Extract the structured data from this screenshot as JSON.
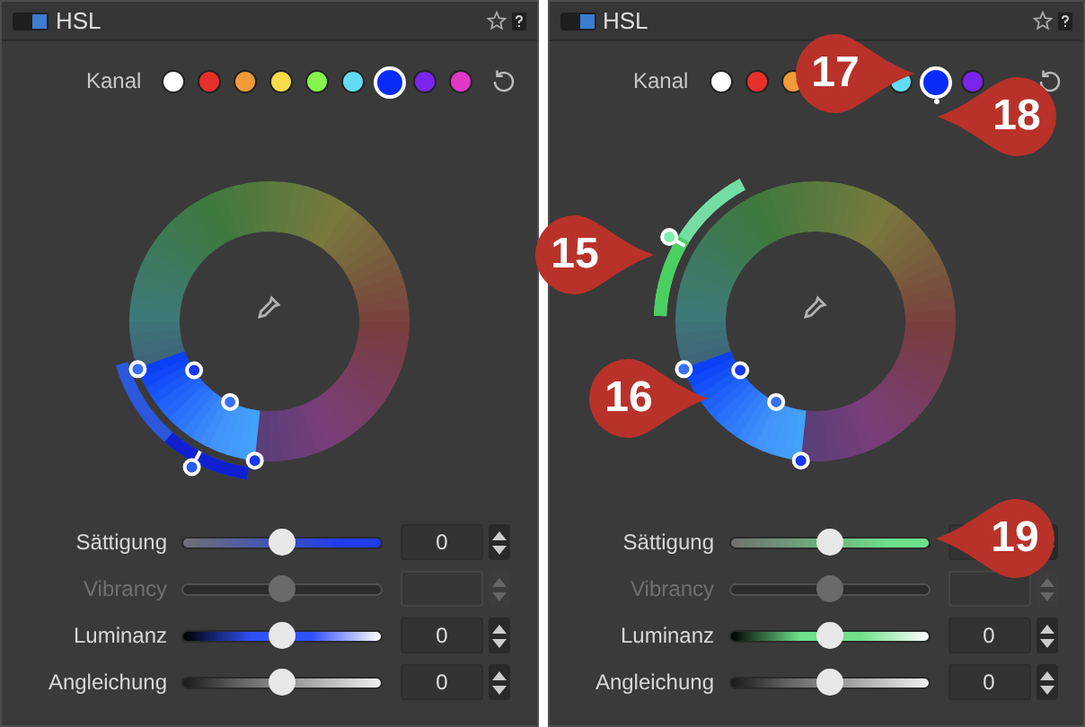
{
  "panels": [
    {
      "title": "HSL",
      "enabled": true,
      "channel_label": "Kanal",
      "channels": [
        {
          "color": "#ffffff",
          "selected": false,
          "modified": false
        },
        {
          "color": "#e8302a",
          "selected": false,
          "modified": false
        },
        {
          "color": "#f09a38",
          "selected": false,
          "modified": false
        },
        {
          "color": "#f6dc48",
          "selected": false,
          "modified": false
        },
        {
          "color": "#86f44a",
          "selected": false,
          "modified": false
        },
        {
          "color": "#62dcf6",
          "selected": false,
          "modified": false
        },
        {
          "color": "#0a2cf8",
          "selected": true,
          "modified": false
        },
        {
          "color": "#7a24f0",
          "selected": false,
          "modified": false
        },
        {
          "color": "#e238c8",
          "selected": false,
          "modified": false
        }
      ],
      "sliders": [
        {
          "label": "Sättigung",
          "kind": "saturation",
          "color": "#1f3cf0",
          "disabled": false,
          "level": 0.5,
          "value": "0"
        },
        {
          "label": "Vibrancy",
          "kind": "vibrancy",
          "disabled": true,
          "level": 0.5
        },
        {
          "label": "Luminanz",
          "kind": "luminance",
          "color": "#3050f8",
          "disabled": false,
          "level": 0.5,
          "value": "0"
        },
        {
          "label": "Angleichung",
          "kind": "blend",
          "disabled": false,
          "level": 0.5,
          "value": "0"
        }
      ]
    },
    {
      "title": "HSL",
      "enabled": true,
      "channel_label": "Kanal",
      "channels": [
        {
          "color": "#ffffff",
          "selected": false,
          "modified": false
        },
        {
          "color": "#e8302a",
          "selected": false,
          "modified": false
        },
        {
          "color": "#f09a38",
          "selected": false,
          "modified": false
        },
        {
          "color": "#62dcf6",
          "selected": false,
          "modified": false
        },
        {
          "color": "#0a2cf8",
          "selected": true,
          "modified": true
        },
        {
          "color": "#7a24f0",
          "selected": false,
          "modified": false
        }
      ],
      "sliders": [
        {
          "label": "Sättigung",
          "kind": "saturation",
          "color": "#6ee08a",
          "disabled": false,
          "level": 0.5
        },
        {
          "label": "Vibrancy",
          "kind": "vibrancy",
          "disabled": true,
          "level": 0.5
        },
        {
          "label": "Luminanz",
          "kind": "luminance",
          "color": "#6ee08a",
          "disabled": false,
          "level": 0.5,
          "value": "0"
        },
        {
          "label": "Angleichung",
          "kind": "blend",
          "disabled": false,
          "level": 0.5,
          "value": "0"
        }
      ],
      "callouts": [
        {
          "text": "17"
        },
        {
          "text": "18"
        },
        {
          "text": "15"
        },
        {
          "text": "16"
        },
        {
          "text": "19"
        }
      ]
    }
  ]
}
